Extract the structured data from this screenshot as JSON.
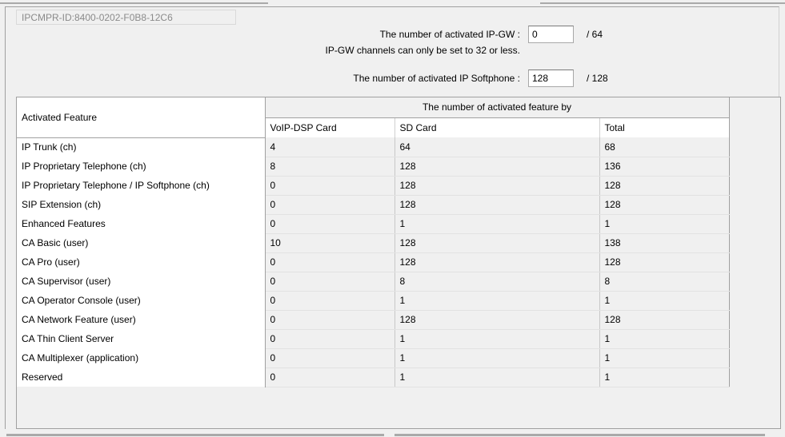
{
  "device_id": "IPCMPR-ID:8400-0202-F0B8-12C6",
  "ipgw": {
    "label": "The number of activated IP-GW :",
    "value": "0",
    "max": "/ 64",
    "note": "IP-GW channels can only be set to 32 or less."
  },
  "softphone": {
    "label": "The number of activated IP Softphone :",
    "value": "128",
    "max": "/ 128"
  },
  "table": {
    "feature_header": "Activated Feature",
    "group_header": "The number of activated feature by",
    "sub_headers": [
      "VoIP-DSP Card",
      "SD Card",
      "Total"
    ],
    "rows": [
      {
        "feature": "IP Trunk (ch)",
        "voip": "4",
        "sd": "64",
        "total": "68"
      },
      {
        "feature": "IP Proprietary Telephone (ch)",
        "voip": "8",
        "sd": "128",
        "total": "136"
      },
      {
        "feature": "IP Proprietary Telephone / IP Softphone (ch)",
        "voip": "0",
        "sd": "128",
        "total": "128"
      },
      {
        "feature": "SIP Extension (ch)",
        "voip": "0",
        "sd": "128",
        "total": "128"
      },
      {
        "feature": "Enhanced Features",
        "voip": "0",
        "sd": "1",
        "total": "1"
      },
      {
        "feature": "CA Basic (user)",
        "voip": "10",
        "sd": "128",
        "total": "138"
      },
      {
        "feature": "CA Pro (user)",
        "voip": "0",
        "sd": "128",
        "total": "128"
      },
      {
        "feature": "CA Supervisor (user)",
        "voip": "0",
        "sd": "8",
        "total": "8"
      },
      {
        "feature": "CA Operator Console (user)",
        "voip": "0",
        "sd": "1",
        "total": "1"
      },
      {
        "feature": "CA Network Feature (user)",
        "voip": "0",
        "sd": "128",
        "total": "128"
      },
      {
        "feature": "CA Thin Client Server",
        "voip": "0",
        "sd": "1",
        "total": "1"
      },
      {
        "feature": "CA Multiplexer (application)",
        "voip": "0",
        "sd": "1",
        "total": "1"
      },
      {
        "feature": "Reserved",
        "voip": "0",
        "sd": "1",
        "total": "1"
      }
    ]
  }
}
